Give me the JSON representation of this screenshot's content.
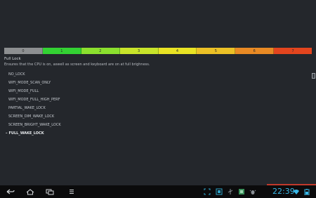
{
  "levels": [
    {
      "label": "0",
      "color": "#8d8f91"
    },
    {
      "label": "1",
      "color": "#33d233"
    },
    {
      "label": "2",
      "color": "#8be02e"
    },
    {
      "label": "3",
      "color": "#c8e42a"
    },
    {
      "label": "4",
      "color": "#e9e324"
    },
    {
      "label": "5",
      "color": "#ecc126"
    },
    {
      "label": "6",
      "color": "#e98a24"
    },
    {
      "label": "7",
      "color": "#e3451e"
    }
  ],
  "lock": {
    "title": "Full Lock",
    "description": "Ensures that the CPU is on, aswell as screen and keyboard are on at full brighness."
  },
  "lock_options": [
    {
      "label": "NO_LOCK",
      "selected": false
    },
    {
      "label": "WIFI_MODE_SCAN_ONLY",
      "selected": false
    },
    {
      "label": "WIFI_MODE_FULL",
      "selected": false
    },
    {
      "label": "WIFI_MODE_FULL_HIGH_PERF",
      "selected": false
    },
    {
      "label": "PARTIAL_WAKE_LOCK",
      "selected": false
    },
    {
      "label": "SCREEN_DIM_WAKE_LOCK",
      "selected": false
    },
    {
      "label": "SCREEN_BRIGHT_WAKE_LOCK",
      "selected": false
    },
    {
      "label": "FULL_WAKE_LOCK",
      "selected": true,
      "marker": "–"
    }
  ],
  "status": {
    "time": "22:39",
    "accent": "#39b8e8"
  },
  "nav_icons": [
    "back-icon",
    "home-icon",
    "recent-apps-icon",
    "menu-icon"
  ],
  "tray_icons": [
    "fullscreen-icon",
    "screenshot-icon",
    "usb-icon",
    "app-notification-icon",
    "bug-icon",
    "wifi-icon",
    "battery-icon"
  ]
}
